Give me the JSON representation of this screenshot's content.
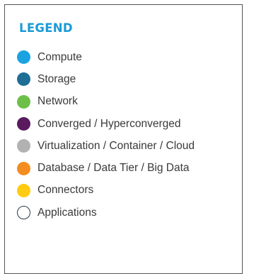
{
  "legend": {
    "title": "LEGEND",
    "items": [
      {
        "label": "Compute",
        "color": "#1aa3e0",
        "style": "filled"
      },
      {
        "label": "Storage",
        "color": "#1f6e96",
        "style": "filled"
      },
      {
        "label": "Network",
        "color": "#6cc04a",
        "style": "filled"
      },
      {
        "label": "Converged / Hyperconverged",
        "color": "#5a1a5e",
        "style": "filled"
      },
      {
        "label": "Virtualization / Container / Cloud",
        "color": "#b2b2b2",
        "style": "filled"
      },
      {
        "label": "Database / Data Tier / Big Data",
        "color": "#f38d22",
        "style": "filled"
      },
      {
        "label": "Connectors",
        "color": "#ffcc11",
        "style": "filled"
      },
      {
        "label": "Applications",
        "color": "#2b3a4e",
        "style": "outline"
      }
    ]
  }
}
